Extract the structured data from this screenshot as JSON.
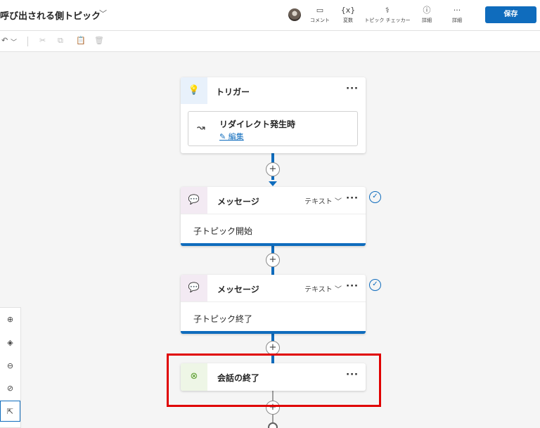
{
  "header": {
    "topic_title": "呼び出される側トピック",
    "title_chevron": "﹀",
    "tools": [
      {
        "icon": "comment-icon",
        "glyph": "▭",
        "label": "コメント"
      },
      {
        "icon": "variable-icon",
        "glyph": "{x}",
        "label": "変数"
      },
      {
        "icon": "stethoscope-icon",
        "glyph": "⚕",
        "label": "トピック チェッカー"
      },
      {
        "icon": "info-icon",
        "glyph": "ⓘ",
        "label": "詳細"
      },
      {
        "icon": "more-icon",
        "glyph": "···",
        "label": "詳細"
      }
    ],
    "save_label": "保存"
  },
  "toolbar2": {
    "undo_glyph": "↶",
    "undo_chevron": "﹀",
    "icons": [
      {
        "icon": "cut-icon",
        "glyph": "✂"
      },
      {
        "icon": "copy-icon",
        "glyph": "⧉"
      },
      {
        "icon": "paste-icon",
        "glyph": "📋"
      },
      {
        "icon": "delete-icon",
        "glyph": "🗑"
      }
    ]
  },
  "nodes": {
    "trigger": {
      "icon_glyph": "💡",
      "title": "トリガー",
      "more": "···",
      "redirect_icon_glyph": "↝",
      "redirect_title": "リダイレクト発生時",
      "edit_label": "✎ 編集"
    },
    "message1": {
      "icon_glyph": "💬",
      "title": "メッセージ",
      "type_label": "テキスト ﹀",
      "more": "···",
      "text": "子トピック開始",
      "check_glyph": "✓"
    },
    "message2": {
      "icon_glyph": "💬",
      "title": "メッセージ",
      "type_label": "テキスト ﹀",
      "more": "···",
      "text": "子トピック終了",
      "check_glyph": "✓"
    },
    "end": {
      "icon_glyph": "⊗",
      "title": "会話の終了",
      "more": "···"
    }
  },
  "plus_glyph": "+",
  "zoom": [
    {
      "icon": "zoom-in-icon",
      "glyph": "⊕"
    },
    {
      "icon": "recenter-icon",
      "glyph": "◈"
    },
    {
      "icon": "zoom-out-icon",
      "glyph": "⊖"
    },
    {
      "icon": "minimap-icon",
      "glyph": "⊘"
    },
    {
      "icon": "select-tool-icon",
      "glyph": "⇱"
    }
  ],
  "colors": {
    "accent": "#0f6cbd",
    "highlight": "#e00000",
    "trigger_icon_bg": "#e8f1fb",
    "message_icon_bg": "#f3eaf3",
    "end_icon_bg": "#eef6e6"
  }
}
